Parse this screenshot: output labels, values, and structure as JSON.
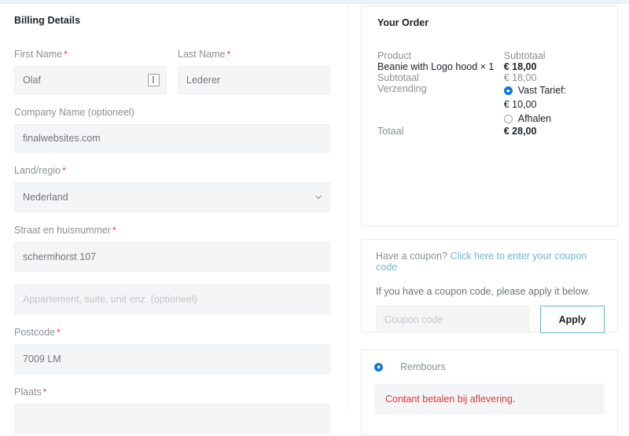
{
  "billing": {
    "title": "Billing Details",
    "fields": [
      {
        "name": "first-name",
        "label": "First Name",
        "required": true,
        "value": "Olaf",
        "placeholder": "",
        "icon": "autofill-icon"
      },
      {
        "name": "last-name",
        "label": "Last Name",
        "required": true,
        "value": "Lederer",
        "placeholder": ""
      },
      {
        "name": "company-name",
        "label": "Company Name (optioneel)",
        "required": false,
        "value": "finalwebsites.com",
        "placeholder": ""
      },
      {
        "name": "country-region",
        "label": "Land/regio",
        "required": true,
        "value": "Nederland",
        "placeholder": "",
        "icon": "chevron-down-icon"
      },
      {
        "name": "street-address",
        "label": "Straat en huisnummer",
        "required": true,
        "value": "schermhorst 107",
        "placeholder": ""
      },
      {
        "name": "address-line-2",
        "label": "",
        "required": false,
        "value": "",
        "placeholder": "Appartement, suite, unit enz. (optioneel)"
      },
      {
        "name": "postcode",
        "label": "Postcode",
        "required": true,
        "value": "7009 LM",
        "placeholder": ""
      },
      {
        "name": "city",
        "label": "Plaats",
        "required": true,
        "value": "",
        "placeholder": ""
      }
    ]
  },
  "order": {
    "title": "Your Order",
    "header": {
      "product": "Product",
      "subtotal": "Subtotaal"
    },
    "line_items": [
      {
        "name": "Beanie with Logo hood  × 1",
        "amount": "€ 18,00"
      }
    ],
    "subtotal": {
      "label": "Subtotaal",
      "amount": "€ 18,00"
    },
    "shipping": {
      "label": "Verzending",
      "options": [
        {
          "label": "Vast Tarief:",
          "price": "€ 10,00",
          "selected": true
        },
        {
          "label": "Afhalen",
          "price": "",
          "selected": false
        }
      ]
    },
    "total": {
      "label": "Totaal",
      "amount": "€ 28,00"
    }
  },
  "coupon": {
    "prompt_prefix": "Have a coupon? ",
    "prompt_link": "Click here to enter your coupon code",
    "help_text": "If you have a coupon code, please apply it below.",
    "input_placeholder": "Coupon code",
    "input_value": "",
    "apply_label": "Apply"
  },
  "payment": {
    "methods": [
      {
        "label": "Rembours",
        "selected": true
      }
    ],
    "note": "Contant betalen bij aflevering."
  },
  "colors": {
    "accent_blue": "#1576d4",
    "link_teal": "#6cb8cf",
    "required_red": "#e03b3b",
    "note_red": "#e03b3b",
    "top_bar": "#eaf4f8"
  }
}
